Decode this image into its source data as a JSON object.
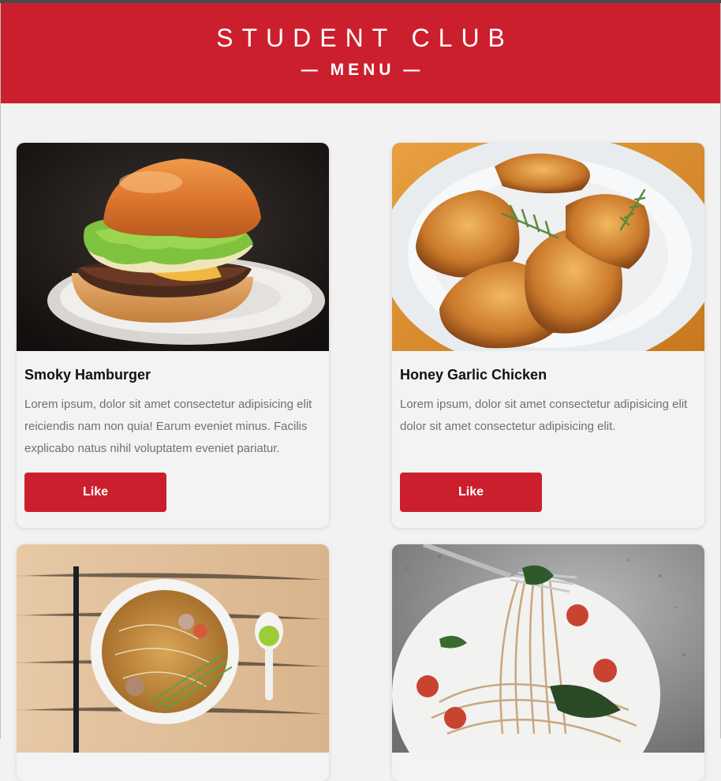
{
  "header": {
    "title": "STUDENT CLUB",
    "subtitle": "— MENU —"
  },
  "colors": {
    "accent": "#cc1f2e",
    "background": "#f2f2f2"
  },
  "menu": [
    {
      "name": "Smoky Hamburger",
      "description": "Lorem ipsum, dolor sit amet consectetur adipisicing elit reiciendis nam non quia! Earum eveniet minus. Facilis explicabo natus nihil voluptatem eveniet pariatur.",
      "button": "Like",
      "image": "hamburger-photo"
    },
    {
      "name": "Honey Garlic Chicken",
      "description": "Lorem ipsum, dolor sit amet consectetur adipisicing elit dolor sit amet consectetur adipisicing elit.",
      "button": "Like",
      "image": "chicken-photo"
    },
    {
      "image": "pho-noodle-soup-photo"
    },
    {
      "image": "spaghetti-photo"
    }
  ]
}
